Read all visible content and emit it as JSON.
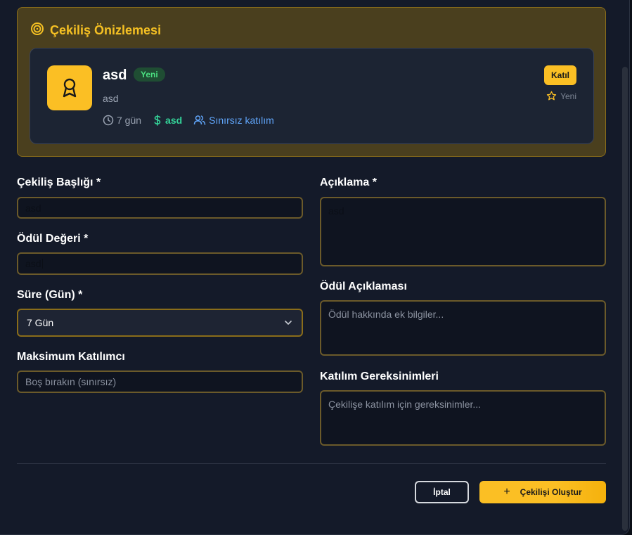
{
  "preview": {
    "title": "Çekiliş Önizlemesi",
    "card": {
      "title": "asd",
      "badge": "Yeni",
      "description": "asd",
      "duration": "7 gün",
      "prize": "asd",
      "participants": "Sınırsız katılım",
      "join_label": "Katıl",
      "status_label": "Yeni"
    }
  },
  "form": {
    "title_label": "Çekiliş Başlığı *",
    "title_value": "asd",
    "prize_label": "Ödül Değeri *",
    "prize_value": "asd",
    "duration_label": "Süre (Gün) *",
    "duration_value": "7 Gün",
    "max_label": "Maksimum Katılımcı",
    "max_placeholder": "Boş bırakın (sınırsız)",
    "desc_label": "Açıklama *",
    "desc_value": "asd",
    "prize_desc_label": "Ödül Açıklaması",
    "prize_desc_placeholder": "Ödül hakkında ek bilgiler...",
    "req_label": "Katılım Gereksinimleri",
    "req_placeholder": "Çekilişe katılım için gereksinimler..."
  },
  "actions": {
    "cancel_label": "İptal",
    "create_label": "Çekilişi Oluştur"
  },
  "colors": {
    "accent": "#fbbf24",
    "badge_green": "#4ade80",
    "link_blue": "#60a5fa"
  }
}
